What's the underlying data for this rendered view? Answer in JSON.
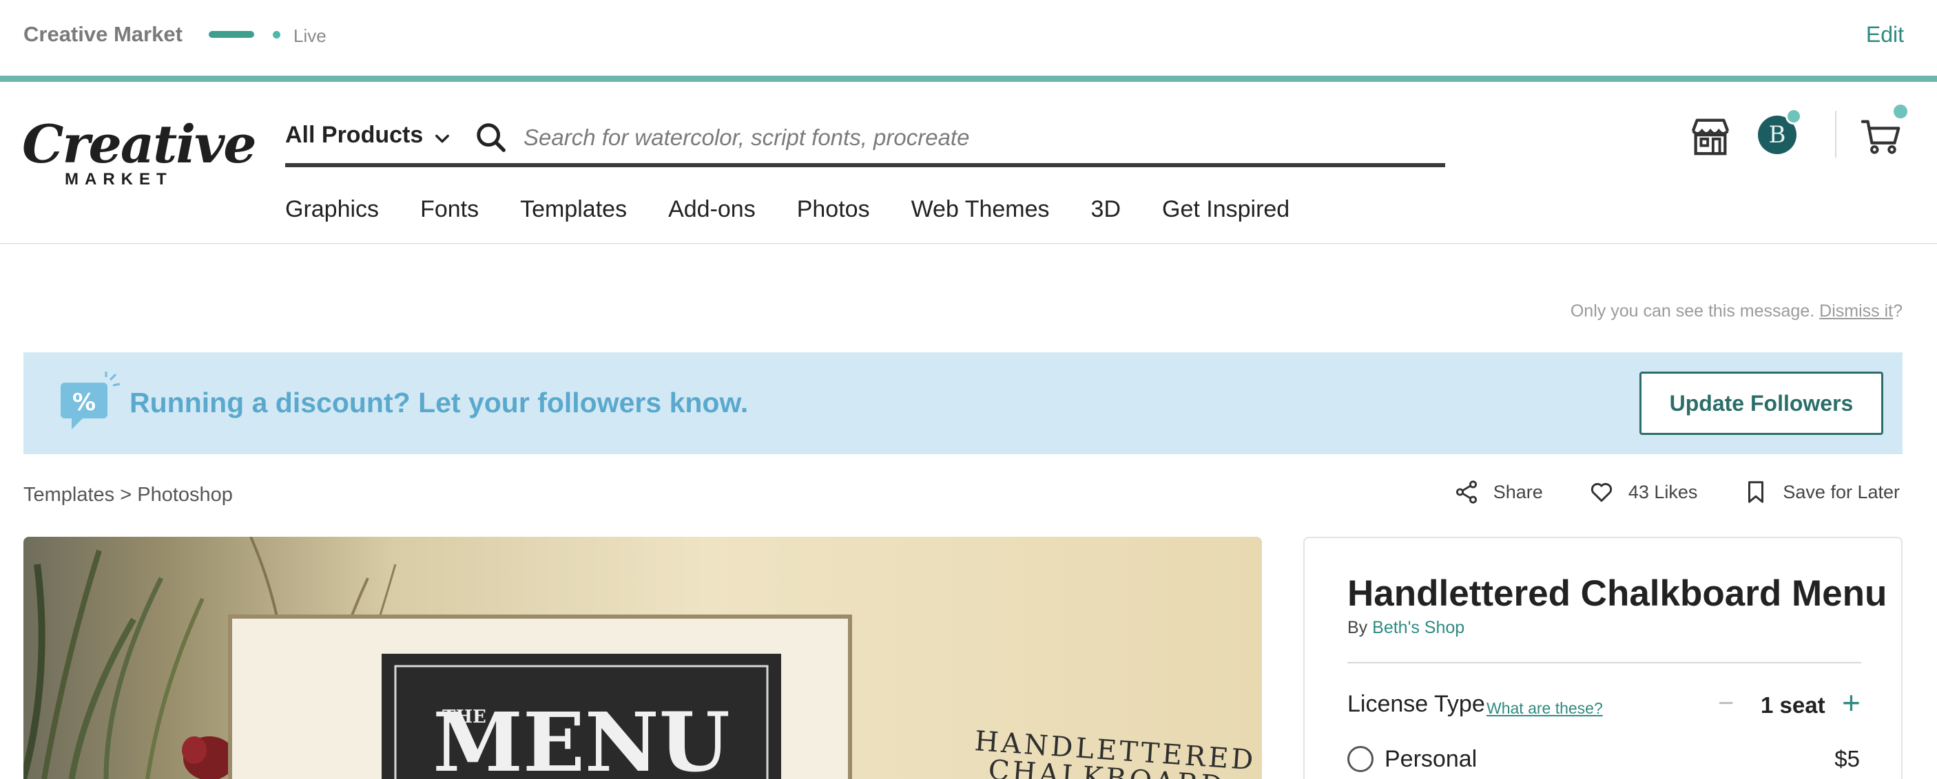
{
  "topbar": {
    "title": "Creative Market",
    "status": "Live",
    "edit_label": "Edit"
  },
  "header": {
    "logo": {
      "word": "Creative",
      "sub": "MARKET"
    },
    "search": {
      "category": "All Products",
      "placeholder": "Search for watercolor, script fonts, procreate"
    },
    "avatar_initial": "B",
    "nav": [
      "Graphics",
      "Fonts",
      "Templates",
      "Add-ons",
      "Photos",
      "Web Themes",
      "3D",
      "Get Inspired"
    ]
  },
  "notice": {
    "text": "Only you can see this message.",
    "dismiss": "Dismiss it",
    "suffix": "?"
  },
  "banner": {
    "text": "Running a discount? Let your followers know.",
    "button": "Update Followers"
  },
  "breadcrumb": "Templates > Photoshop",
  "actions": {
    "share": "Share",
    "likes": "43 Likes",
    "save": "Save for Later"
  },
  "product": {
    "image_text": {
      "menu": "MENU",
      "the": "THE",
      "line1": "HANDLETTERED",
      "line2": "CHALKBOARD"
    },
    "title": "Handlettered Chalkboard Menu",
    "by_prefix": "By",
    "shop": "Beth's Shop",
    "license_label": "License Type",
    "license_help": "What are these?",
    "seats_minus": "−",
    "seats": "1 seat",
    "seats_plus": "+",
    "options": [
      {
        "label": "Personal",
        "price": "$5"
      }
    ]
  },
  "colors": {
    "accent": "#2e8a80",
    "banner_bg": "#d2e9f5",
    "banner_text": "#5aa9cd"
  },
  "icons": [
    "search-icon",
    "chevron-down-icon",
    "shop-icon",
    "cart-icon",
    "share-icon",
    "heart-icon",
    "bookmark-icon",
    "discount-chat-icon"
  ]
}
